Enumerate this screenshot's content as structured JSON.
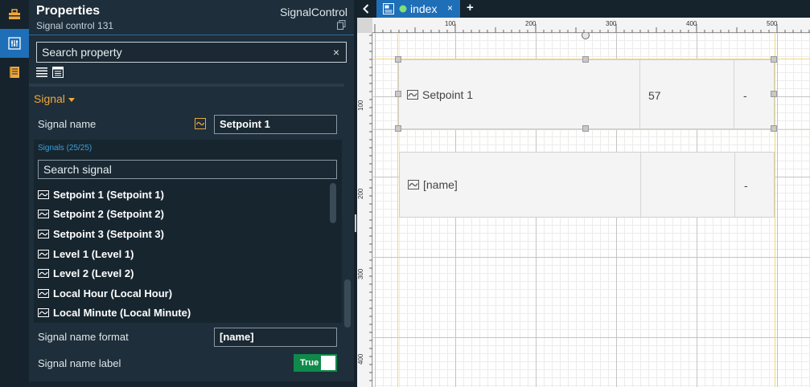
{
  "panel": {
    "title": "Properties",
    "subtitle": "Signal control 131",
    "control_type": "SignalControl",
    "search_placeholder": "Search property",
    "search_clear": "×"
  },
  "group": {
    "title": "Signal"
  },
  "props": {
    "signal_name_label": "Signal name",
    "signal_name_value": "Setpoint 1",
    "signals_count": "Signals (25/25)",
    "signals_search_placeholder": "Search signal",
    "signal_name_format_label": "Signal name format",
    "signal_name_format_value": "[name]",
    "signal_name_label_label": "Signal name label",
    "toggle_value": "True"
  },
  "signals": [
    "Setpoint 1 (Setpoint 1)",
    "Setpoint 2 (Setpoint 2)",
    "Setpoint 3 (Setpoint 3)",
    "Level 1 (Level 1)",
    "Level 2 (Level 2)",
    "Local Hour (Local Hour)",
    "Local Minute (Local Minute)"
  ],
  "tabs": {
    "back": "<",
    "active_tab": "index",
    "close": "×",
    "add": "+"
  },
  "ruler": {
    "top": [
      "100",
      "200",
      "300",
      "400",
      "500"
    ],
    "left": [
      "100",
      "200",
      "300",
      "400"
    ]
  },
  "canvas": {
    "rows": [
      {
        "name": "Setpoint 1",
        "value": "57",
        "unit": "-"
      },
      {
        "name": "[name]",
        "value": "",
        "unit": "-"
      }
    ]
  },
  "colors": {
    "accent_blue": "#1e6fb8",
    "group_orange": "#f0a73a",
    "toggle_green": "#0f8a4a",
    "count_blue": "#3aa0d8"
  },
  "icons": {
    "iconbar": [
      "toolbox-icon",
      "properties-icon",
      "document-list-icon"
    ],
    "signal": "signal-wave-icon"
  }
}
